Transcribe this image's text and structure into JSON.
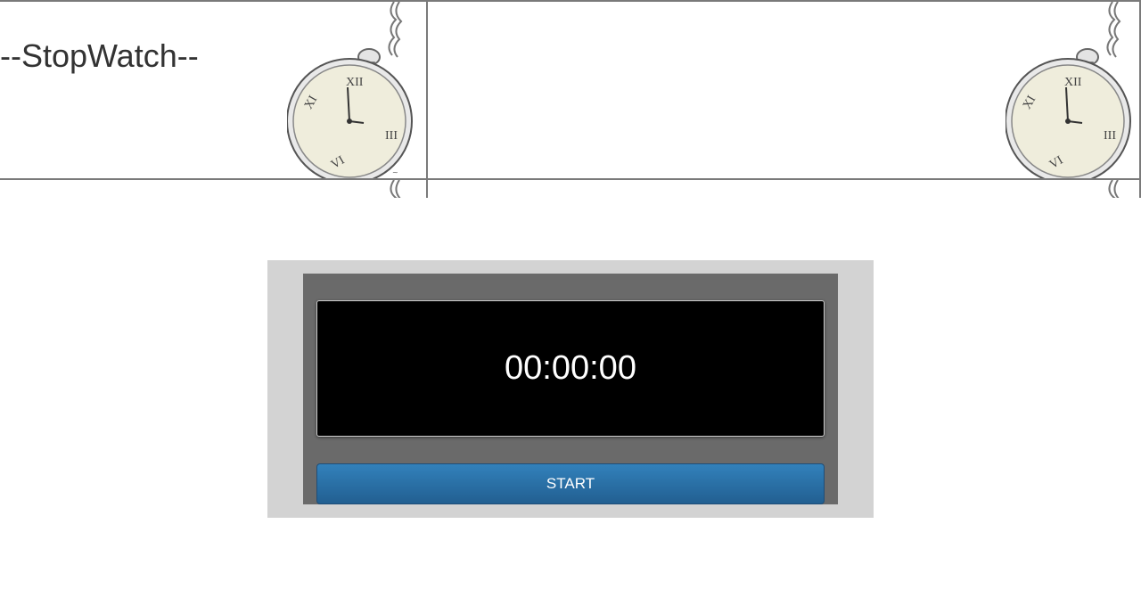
{
  "header": {
    "title": "--StopWatch--",
    "banner_art": "pocket-watch-icon"
  },
  "stopwatch": {
    "time": "00:00:00",
    "start_label": "START"
  },
  "colors": {
    "widget_outer": "#d3d3d3",
    "widget_inner": "#6a6a6a",
    "display_bg": "#000000",
    "display_text": "#ffffff",
    "button_top": "#3281bb",
    "button_bottom": "#225f91",
    "title_text": "#333333"
  }
}
